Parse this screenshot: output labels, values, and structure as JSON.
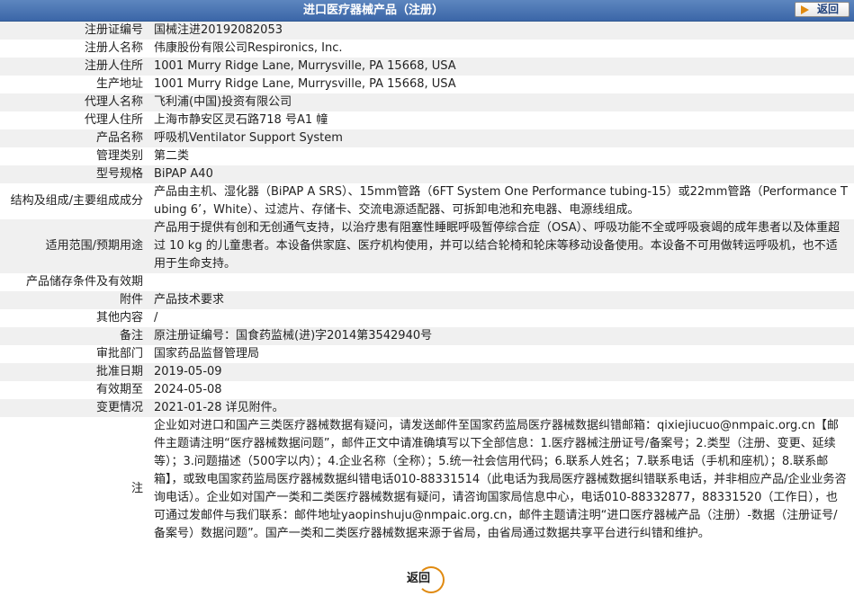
{
  "header": {
    "title": "进口医疗器械产品（注册）",
    "back_label": "返回"
  },
  "fields": [
    {
      "label": "注册证编号",
      "value": "国械注进20192082053"
    },
    {
      "label": "注册人名称",
      "value": "伟康股份有限公司Respironics, Inc."
    },
    {
      "label": "注册人住所",
      "value": "1001 Murry Ridge Lane, Murrysville, PA 15668, USA"
    },
    {
      "label": "生产地址",
      "value": "1001 Murry Ridge Lane, Murrysville, PA 15668, USA"
    },
    {
      "label": "代理人名称",
      "value": "飞利浦(中国)投资有限公司"
    },
    {
      "label": "代理人住所",
      "value": "上海市静安区灵石路718 号A1 幢"
    },
    {
      "label": "产品名称",
      "value": "呼吸机Ventilator Support System"
    },
    {
      "label": "管理类别",
      "value": "第二类"
    },
    {
      "label": "型号规格",
      "value": "BiPAP A40"
    },
    {
      "label": "结构及组成/主要组成成分",
      "value": "产品由主机、湿化器（BiPAP A SRS）、15mm管路（6FT System One Performance tubing-15）或22mm管路（Performance Tubing 6’，White）、过滤片、存储卡、交流电源适配器、可拆卸电池和充电器、电源线组成。"
    },
    {
      "label": "适用范围/预期用途",
      "value": "产品用于提供有创和无创通气支持，以治疗患有阻塞性睡眠呼吸暂停综合症（OSA）、呼吸功能不全或呼吸衰竭的成年患者以及体重超过 10 kg 的儿童患者。本设备供家庭、医疗机构使用，并可以结合轮椅和轮床等移动设备使用。本设备不可用做转运呼吸机，也不适用于生命支持。"
    },
    {
      "label": "产品储存条件及有效期",
      "value": ""
    },
    {
      "label": "附件",
      "value": "产品技术要求"
    },
    {
      "label": "其他内容",
      "value": "/"
    },
    {
      "label": "备注",
      "value": "原注册证编号：国食药监械(进)字2014第3542940号"
    },
    {
      "label": "审批部门",
      "value": "国家药品监督管理局"
    },
    {
      "label": "批准日期",
      "value": "2019-05-09"
    },
    {
      "label": "有效期至",
      "value": "2024-05-08"
    },
    {
      "label": "变更情况",
      "value": "2021-01-28 详见附件。"
    },
    {
      "label": "注",
      "value": "企业如对进口和国产三类医疗器械数据有疑问，请发送邮件至国家药监局医疗器械数据纠错邮箱：qixiejiucuo@nmpaic.org.cn【邮件主题请注明“医疗器械数据问题”，邮件正文中请准确填写以下全部信息：1.医疗器械注册证号/备案号；2.类型（注册、变更、延续等）；3.问题描述（500字以内）；4.企业名称（全称）；5.统一社会信用代码；6.联系人姓名；7.联系电话（手机和座机）；8.联系邮箱】，或致电国家药监局医疗器械数据纠错电话010-88331514（此电话为我局医疗器械数据纠错联系电话，并非相应产品/企业业务咨询电话）。企业如对国产一类和二类医疗器械数据有疑问，请咨询国家局信息中心，电话010-88332877，88331520（工作日），也可通过发邮件与我们联系：邮件地址yaopinshuju@nmpaic.org.cn，邮件主题请注明“进口医疗器械产品（注册）-数据（注册证号/备案号）数据问题”。国产一类和二类医疗器械数据来源于省局，由省局通过数据共享平台进行纠错和维护。"
    }
  ],
  "footer": {
    "back_label": "返回"
  }
}
